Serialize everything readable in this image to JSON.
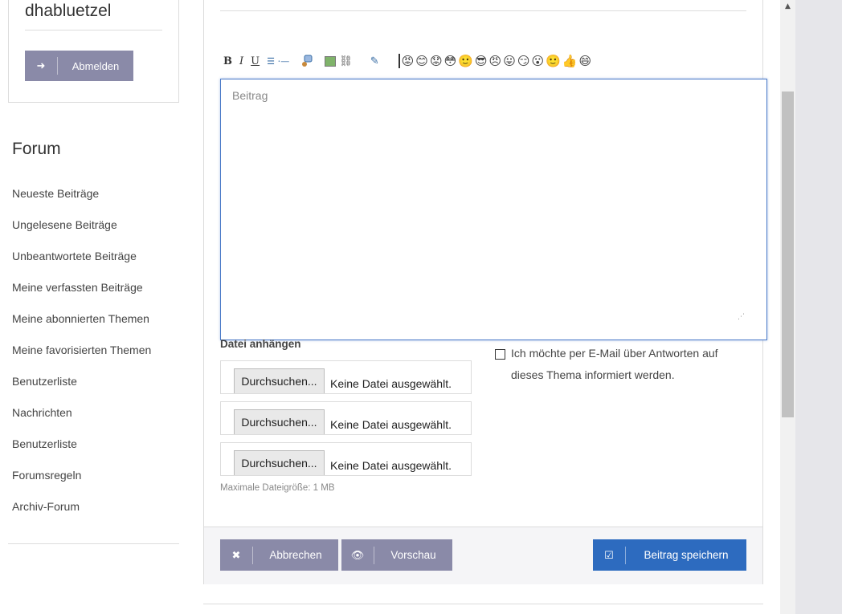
{
  "user": {
    "name": "dhabluetzel",
    "logout_label": "Abmelden",
    "logout_icon": "sign-out-icon"
  },
  "forum": {
    "title": "Forum",
    "nav": [
      "Neueste Beiträge",
      "Ungelesene Beiträge",
      "Unbeantwortete Beiträge",
      "Meine verfassten Beiträge",
      "Meine abonnierten Themen",
      "Meine favorisierten Themen",
      "Benutzerliste",
      "Nachrichten",
      "Benutzerliste",
      "Forumsregeln",
      "Archiv-Forum"
    ]
  },
  "toolbar": {
    "bold": "B",
    "italic": "I",
    "underline": "U",
    "list": "☰ ⋅—",
    "link": "⛓",
    "color": "✎",
    "smileys": [
      "😡",
      "😊",
      "😟",
      "😳",
      "🙂",
      "😎",
      "😠",
      "😛",
      "😏",
      "😮",
      "🙂",
      "👍",
      "😄"
    ]
  },
  "editor": {
    "placeholder": "Beitrag"
  },
  "attachments": {
    "title": "Datei anhängen",
    "browse_label": "Durchsuchen...",
    "status": "Keine Datei ausgewählt.",
    "max_size": "Maximale Dateigröße: 1 MB"
  },
  "notify": {
    "label": "Ich möchte per E-Mail über Antworten auf dieses Thema informiert werden.",
    "checked": false
  },
  "actions": {
    "cancel_label": "Abbrechen",
    "preview_label": "Vorschau",
    "save_label": "Beitrag speichern"
  },
  "colors": {
    "secondary_button": "#8a8aa8",
    "primary_button": "#2d6bbf",
    "editor_border": "#4a7ac8"
  }
}
